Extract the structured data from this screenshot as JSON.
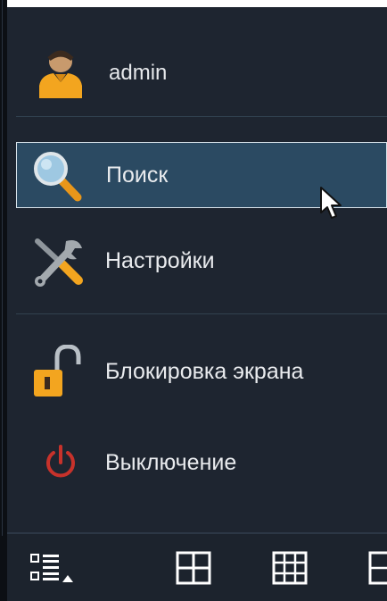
{
  "user": {
    "name": "admin",
    "icon": "user-icon"
  },
  "menu": {
    "items": [
      {
        "label": "Поиск",
        "icon": "search-icon",
        "selected": true
      },
      {
        "label": "Настройки",
        "icon": "settings-tools-icon",
        "selected": false
      },
      {
        "label": "Блокировка экрана",
        "icon": "lock-icon",
        "selected": false
      },
      {
        "label": "Выключение",
        "icon": "power-icon",
        "selected": false
      }
    ]
  },
  "toolbar": {
    "buttons": [
      {
        "icon": "layout-menu-icon"
      },
      {
        "icon": "grid-2x2-icon"
      },
      {
        "icon": "grid-3x3-icon"
      },
      {
        "icon": "grid-partial-icon"
      }
    ]
  },
  "colors": {
    "panel_bg": "#1e2530",
    "selected_bg": "#2b4a62",
    "text": "#e9ebee",
    "accent_orange": "#f3a51f",
    "power_red": "#c7322b"
  }
}
